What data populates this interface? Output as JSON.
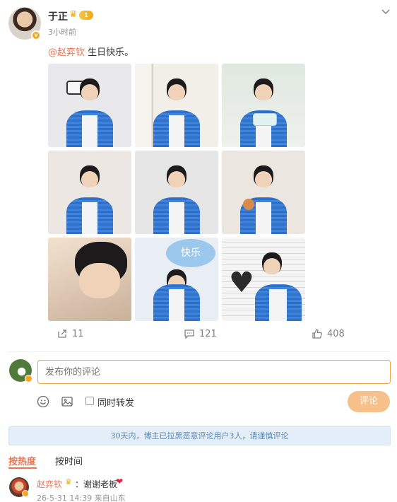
{
  "post": {
    "author": "于正",
    "timestamp": "3小时前",
    "mention": "@赵弈钦",
    "text": " 生日快乐。",
    "vip_level": "1",
    "verified_mark": "v",
    "photos": [
      {
        "icon": "photo-boombox",
        "bg": "#e9e9eb"
      },
      {
        "icon": "photo-window",
        "bg": "#f2eee8"
      },
      {
        "icon": "photo-cake",
        "bg": "#e4ebe4"
      },
      {
        "icon": "photo-crown-pose",
        "bg": "#ece7e2"
      },
      {
        "icon": "photo-crown-smile",
        "bg": "#e6e6e6"
      },
      {
        "icon": "photo-donut",
        "bg": "#ebe6e0"
      },
      {
        "icon": "photo-closeup",
        "bg": "#d8c9b8"
      },
      {
        "icon": "photo-balloon",
        "bg": "#e8eef3"
      },
      {
        "icon": "photo-heart-wall",
        "bg": "#efefef"
      }
    ],
    "balloon_text": "快乐",
    "actions": {
      "repost_count": "11",
      "comment_count": "121",
      "like_count": "408"
    }
  },
  "composer": {
    "placeholder": "发布你的评论",
    "repost_label": "同时转发",
    "submit_label": "评论"
  },
  "notice": "30天内，博主已拉黑恶意评论用户3人，请谨慎评论",
  "sort_tabs": {
    "hot": "按热度",
    "time": "按时间"
  },
  "comments": [
    {
      "author": "赵弈钦",
      "text": "：谢谢老板",
      "heart": "❤",
      "meta": "26-5-31 14:39 来自山东"
    }
  ],
  "colors": {
    "accent": "#eb7350",
    "input_border": "#f0a341",
    "submit_bg": "#f7c08a",
    "notice_bg": "#e3eef9"
  }
}
